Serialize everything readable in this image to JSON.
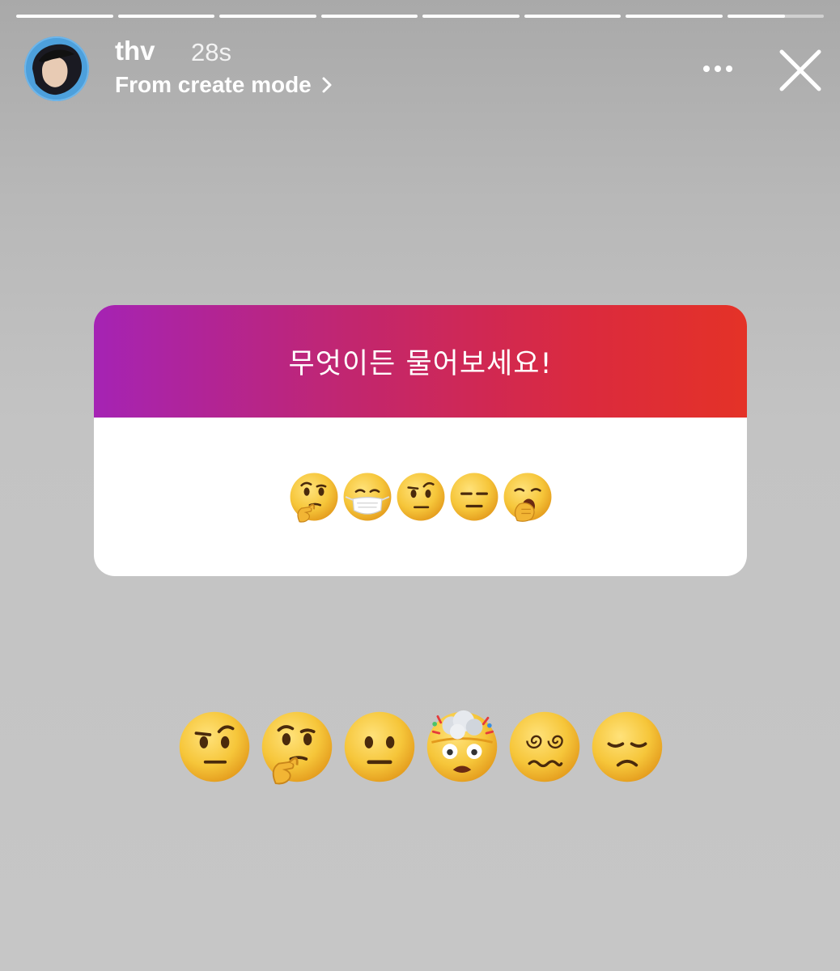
{
  "story": {
    "segments": [
      1,
      1,
      1,
      1,
      1,
      1,
      1,
      0.6
    ],
    "username": "thv",
    "timestamp": "28s",
    "subtitle": "From create mode",
    "icons": {
      "avatar": "profile-avatar",
      "more": "more-dots-icon",
      "close": "close-icon",
      "subtitle_chevron": "chevron-right-icon"
    }
  },
  "question_card": {
    "title": "무엇이든 물어보세요!",
    "emojis": [
      "thinking-face",
      "face-with-medical-mask",
      "face-with-raised-eyebrow",
      "expressionless-face",
      "yawning-face"
    ]
  },
  "sticker_row": {
    "emojis": [
      "face-with-raised-eyebrow",
      "thinking-face",
      "neutral-face",
      "exploding-head",
      "face-with-spiral-eyes",
      "disappointed-face"
    ]
  },
  "colors": {
    "card_gradient_start": "#a523b4",
    "card_gradient_end": "#e43227",
    "emoji_yellow": "#f6c63a"
  }
}
